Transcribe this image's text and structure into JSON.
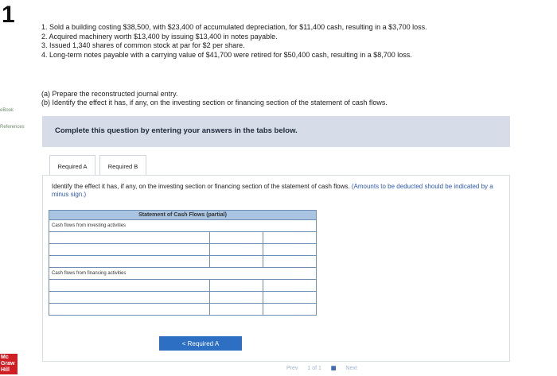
{
  "page_number": "1",
  "rail": {
    "ebook": "eBook",
    "references": "References"
  },
  "problem_items": [
    "1. Sold a building costing $38,500, with $23,400 of accumulated depreciation, for $11,400 cash, resulting in a $3,700 loss.",
    "2. Acquired machinery worth $13,400 by issuing $13,400 in notes payable.",
    "3. Issued 1,340 shares of common stock at par for $2 per share.",
    "4. Long-term notes payable with a carrying value of $41,700 were retired for $50,400 cash, resulting in a $8,700 loss."
  ],
  "parts": [
    "(a) Prepare the reconstructed journal entry.",
    "(b) Identify the effect it has, if any, on the investing section or financing section of the statement of cash flows."
  ],
  "instruction": "Complete this question by entering your answers in the tabs below.",
  "tabs": {
    "a": "Required A",
    "b": "Required B"
  },
  "panel": {
    "prompt": "Identify the effect it has, if any, on the investing section or financing section of the statement of cash flows.",
    "note": "(Amounts to be deducted should be indicated by a minus sign.)"
  },
  "table": {
    "title": "Statement of Cash Flows (partial)",
    "investing_label": "Cash flows from investing activities",
    "financing_label": "Cash flows from financing activities"
  },
  "buttons": {
    "required_a": "< Required A"
  },
  "pager": {
    "prev": "Prev",
    "position": "1 of 1",
    "next": "Next"
  },
  "logo_text": "Mc Graw Hill",
  "colors": {
    "instruction_bg": "#d6dde8",
    "table_header": "#a9c5e1",
    "button": "#2d6fc2",
    "brand_red": "#cf1f25"
  }
}
